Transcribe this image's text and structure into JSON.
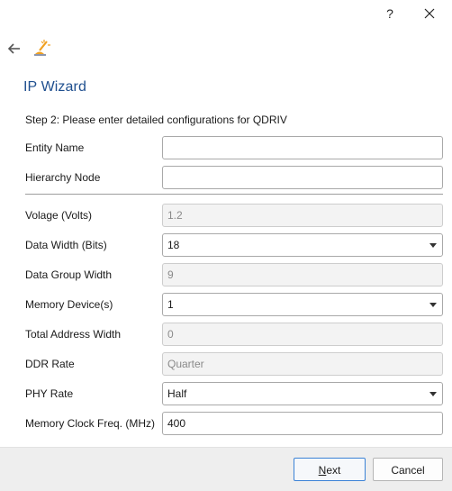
{
  "window": {
    "help_label": "?",
    "help_icon": "question-mark-icon",
    "close_icon": "close-icon"
  },
  "toolbar": {
    "back_icon": "back-arrow-icon",
    "app_icon": "wizard-wand-icon"
  },
  "wizard": {
    "title": "IP Wizard",
    "step_text": "Step 2: Please enter detailed configurations for QDRIV"
  },
  "fields": {
    "entity_name": {
      "label": "Entity Name",
      "value": ""
    },
    "hierarchy_node": {
      "label": "Hierarchy Node",
      "value": ""
    },
    "voltage": {
      "label": "Volage (Volts)",
      "value": "1.2"
    },
    "data_width": {
      "label": "Data Width (Bits)",
      "value": "18"
    },
    "data_group_width": {
      "label": "Data Group Width",
      "value": "9"
    },
    "memory_devices": {
      "label": "Memory Device(s)",
      "value": "1"
    },
    "total_address_width": {
      "label": "Total Address Width",
      "value": "0"
    },
    "ddr_rate": {
      "label": "DDR Rate",
      "value": "Quarter"
    },
    "phy_rate": {
      "label": "PHY Rate",
      "value": "Half"
    },
    "memory_clock_freq": {
      "label": "Memory Clock Freq. (MHz)",
      "value": "400"
    }
  },
  "buttons": {
    "next_mnemonic": "N",
    "next_rest": "ext",
    "cancel": "Cancel"
  },
  "colors": {
    "title": "#1f4f8f",
    "accent_border": "#3b82d6",
    "footer_bg": "#eeeeee",
    "disabled_bg": "#f3f3f3",
    "app_icon_orange": "#f0a020"
  }
}
